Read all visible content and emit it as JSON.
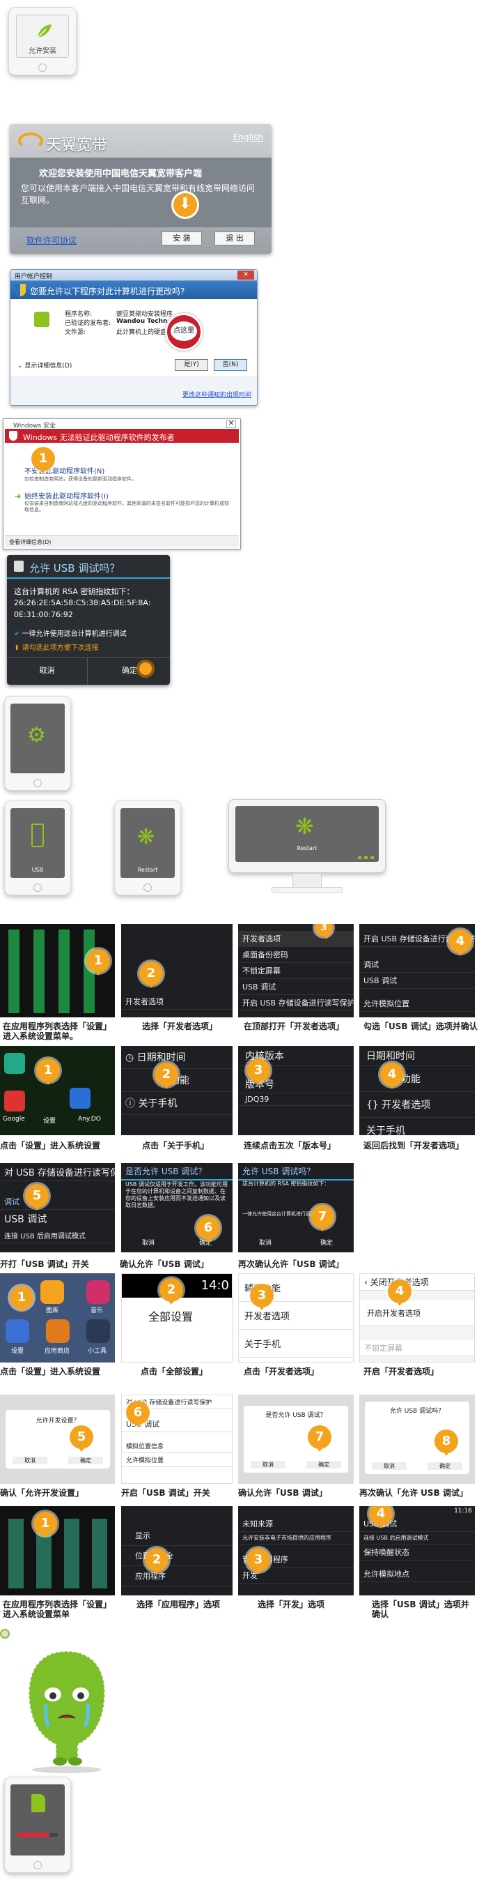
{
  "phone1": {
    "label": "允许安装"
  },
  "tianyi": {
    "brand": "天翼宽带",
    "lang_link": "English",
    "welcome": "欢迎您安装使用中国电信天翼宽带客户端",
    "description": "您可以使用本客户端接入中国电信天翼宽带和有线宽带网络访问互联网。",
    "license_link": "软件许可协议",
    "install_button": "安 装",
    "exit_button": "退 出"
  },
  "uac": {
    "title": "用户帐户控制",
    "question": "您要允许以下程序对此计算机进行更改吗?",
    "program_name_label": "程序名称:",
    "program_name_value": "豌豆荚驱动安装程序",
    "publisher_label": "已验证的发布者:",
    "publisher_value": "Wandou Technology",
    "file_source_label": "文件源:",
    "file_source_value": "此计算机上的硬盘驱动器",
    "click_hint": "点这里",
    "details_toggle": "显示详细信息(D)",
    "yes_button": "是(Y)",
    "no_button": "否(N)",
    "settings_link": "更改这些通知的出现时间"
  },
  "winsec": {
    "title": "Windows 安全",
    "warning": "Windows 无法验证此驱动程序软件的发布者",
    "option1_title": "不安装此驱动程序软件(N)",
    "option1_desc": "应检查制造商网站，获得设备的更新驱动程序软件。",
    "option2_title": "始终安装此驱动程序软件(I)",
    "option2_desc": "仅安装来自制造商网站或光盘的驱动程序软件。其他来源的未签名软件可能损坏您的计算机或窃取信息。",
    "details": "查看详细信息(D)",
    "step": "1"
  },
  "usbdebug": {
    "title": "允许 USB 调试吗？",
    "body": "这台计算机的 RSA 密钥指纹如下：",
    "fingerprint_line1": "26:26:2E:5A:58:C5:38:A5:DE:5F:8A:",
    "fingerprint_line2": "0E:31:00:76:92",
    "always_allow": "一律允许使用这台计算机进行调试",
    "notice": "请勾选此项方便下次连接",
    "cancel": "取消",
    "confirm": "确定"
  },
  "status_phones": {
    "usb_label": "USB",
    "restart_label": "Restart",
    "monitor_label": "Restart"
  },
  "grid_row1": {
    "captions": [
      "在应用程序列表选择「设置」进入系统设置菜单。",
      "选择「开发者选项」",
      "在顶部打开「开发者选项」",
      "勾选「USB 调试」选项并确认"
    ],
    "screen2_items": [
      "开发者选项"
    ],
    "screen3_header": "开发者选项",
    "screen3_items": [
      "桌面备份密码",
      "不锁定屏幕",
      "USB 调试",
      "开启 USB 存储设备进行读写保护"
    ],
    "screen4_items": [
      "开启 USB 存储设备进行读写保护",
      "调试",
      "USB 调试",
      "允许模拟位置"
    ],
    "steps": [
      "1",
      "2",
      "3",
      "4"
    ]
  },
  "grid_row2": {
    "captions": [
      "点击「设置」进入系统设置",
      "点击「关于手机」",
      "连续点击五次「版本号」",
      "返回后找到「开发者选项」"
    ],
    "screen2_items": [
      "日期和时间",
      "功能",
      "关于手机"
    ],
    "screen3_items": [
      "内核版本",
      "版本号",
      "JDQ39"
    ],
    "screen4_items": [
      "日期和时间",
      "功能",
      "{} 开发者选项",
      "关于手机"
    ],
    "icon_labels": [
      "Google",
      "设置",
      "Any.DO"
    ],
    "steps": [
      "1",
      "2",
      "3",
      "4"
    ]
  },
  "grid_row3": {
    "captions": [
      "开打「USB 调试」开关",
      "确认允许「USB 调试」",
      "再次确认允许「USB 调试」"
    ],
    "screen1_items": [
      "对 USB 存储设备进行读写保护",
      "调试",
      "USB 调试",
      "连接 USB 后启用调试模式"
    ],
    "screen2_title": "是否允许 USB 调试？",
    "screen2_body": "USB 调试仅适用于开发工作。该功能可用于在您的计算机和设备之间复制数据、在您的设备上安装应用而不发送通知以及读取日志数据。",
    "screen3_title": "允许 USB 调试吗？",
    "screen3_body": "这台计算机的 RSA 密钥指纹如下：",
    "screen3_always": "一律允许使用这台计算机进行调试",
    "cancel": "取消",
    "ok": "确定",
    "steps": [
      "5",
      "6",
      "7"
    ]
  },
  "grid_row4": {
    "captions": [
      "点击「设置」进入系统设置",
      "点击「全部设置」",
      "点击「开发者选项」",
      "开启「开发者选项」"
    ],
    "screen2_title": "全部设置",
    "screen2_time": "14:0",
    "screen3_items": [
      "辅助功能",
      "开发者选项",
      "关于手机"
    ],
    "screen4_header": "关闭开发者选项",
    "screen4_items": [
      "开启开发者选项",
      "不锁定屏幕"
    ],
    "icon_labels": [
      "图库",
      "音乐",
      "设置",
      "应用商店",
      "小工具"
    ],
    "steps": [
      "1",
      "2",
      "3",
      "4"
    ]
  },
  "grid_row5": {
    "captions": [
      "确认「允许开发设置」",
      "开启「USB 调试」开关",
      "确认允许「USB 调试」",
      "再次确认「允许 USB 调试」"
    ],
    "screen1_title": "允许开发设置？",
    "screen3_title": "是否允许 USB 调试？",
    "screen4_title": "允许 USB 调试吗？",
    "screen2_items": [
      "对 USB 存储设备进行读写保护",
      "USB 调试",
      "模拟位置信息",
      "允许模拟位置"
    ],
    "cancel": "取消",
    "ok": "确定",
    "steps": [
      "5",
      "6",
      "7",
      "8"
    ]
  },
  "grid_row6": {
    "captions": [
      "在应用程序列表选择「设置」进入系统设置菜单",
      "选择「应用程序」选项",
      "选择「开发」选项",
      "选择「USB 调试」选项并确认"
    ],
    "screen2_items": [
      "显示",
      "位置和安全",
      "应用程序"
    ],
    "screen3_items": [
      "未知来源",
      "允许安装非电子市场提供的应用程序",
      "管理应用程序",
      "开发"
    ],
    "screen4_items": [
      "USB 调试",
      "连接 USB 后启用调试模式",
      "保持唤醒状态",
      "允许模拟地点"
    ],
    "time": "11:16",
    "steps": [
      "1",
      "2",
      "3",
      "4"
    ]
  },
  "colors": {
    "accent": "#f4a31c",
    "android_green": "#8dc21f",
    "uac_blue": "#2f6fb3",
    "warning_red": "#c8202a"
  }
}
